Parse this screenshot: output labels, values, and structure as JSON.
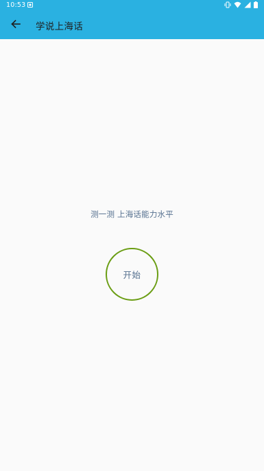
{
  "status_bar": {
    "time": "10:53",
    "icons": [
      "notification-icon",
      "vibrate-icon",
      "wifi-icon",
      "signal-icon",
      "battery-icon"
    ]
  },
  "toolbar": {
    "back_icon": "arrow-back-icon",
    "title": "学说上海话"
  },
  "main": {
    "prompt": "测一测 上海话能力水平",
    "start_label": "开始"
  },
  "colors": {
    "appbar": "#2ab1e1",
    "background": "#fafafa",
    "text_blue_gray": "#55708f",
    "start_ring": "#6a9d13",
    "title_text": "#1f1f1f"
  }
}
